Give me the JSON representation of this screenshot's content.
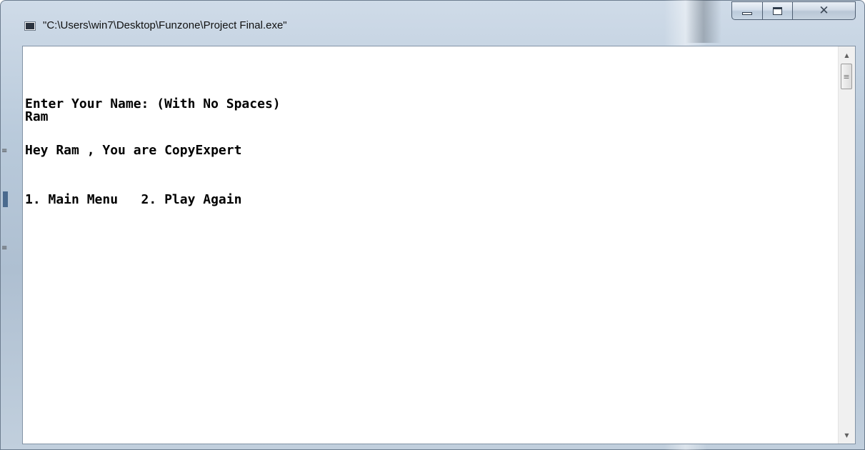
{
  "window": {
    "title": "\"C:\\Users\\win7\\Desktop\\Funzone\\Project Final.exe\""
  },
  "console": {
    "lines": [
      "Enter Your Name: (With No Spaces)",
      "Ram",
      "Hey Ram , You are CopyExpert",
      "1. Main Menu   2. Play Again"
    ]
  },
  "icons": {
    "app": "console-app-icon",
    "minimize": "minimize-icon",
    "maximize": "maximize-icon",
    "close": "close-icon",
    "scroll_up": "scroll-up-icon",
    "scroll_down": "scroll-down-icon",
    "scroll_thumb_grip": "grip-icon"
  },
  "colors": {
    "console_background": "#ffffff",
    "console_text": "#000000",
    "frame": "#b9cadb"
  }
}
